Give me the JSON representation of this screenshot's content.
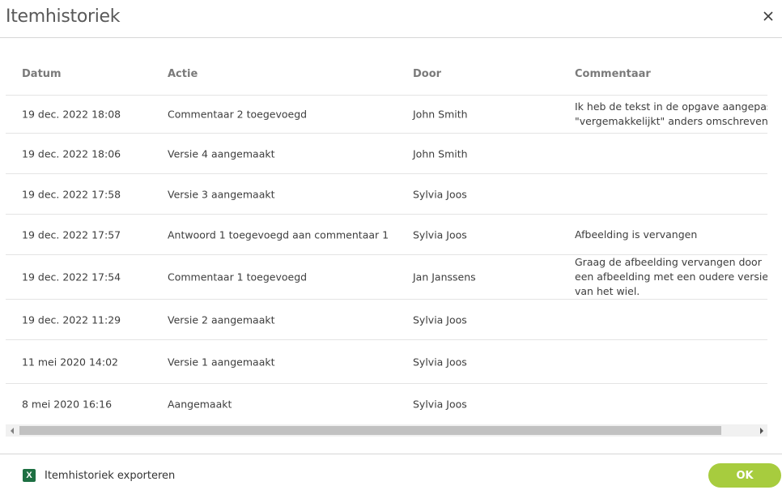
{
  "dialog": {
    "title": "Itemhistoriek",
    "close_icon": "close-icon"
  },
  "table": {
    "headers": {
      "date": "Datum",
      "action": "Actie",
      "by": "Door",
      "comment": "Commentaar"
    },
    "rows": [
      {
        "date": "19 dec. 2022 18:08",
        "action": "Commentaar 2 toegevoegd",
        "by": "John Smith",
        "comment": "Ik heb de tekst in de opgave aangepast: \"vergemakkelijkt\" anders omschreven"
      },
      {
        "date": "19 dec. 2022 18:06",
        "action": "Versie 4 aangemaakt",
        "by": "John Smith",
        "comment": ""
      },
      {
        "date": "19 dec. 2022 17:58",
        "action": "Versie 3 aangemaakt",
        "by": "Sylvia Joos",
        "comment": ""
      },
      {
        "date": "19 dec. 2022 17:57",
        "action": "Antwoord 1 toegevoegd aan commentaar 1",
        "by": "Sylvia Joos",
        "comment": "Afbeelding is vervangen"
      },
      {
        "date": "19 dec. 2022 17:54",
        "action": "Commentaar 1 toegevoegd",
        "by": "Jan Janssens",
        "comment": "Graag de afbeelding vervangen door een afbeelding met een oudere versie van het wiel."
      },
      {
        "date": "19 dec. 2022 11:29",
        "action": "Versie 2 aangemaakt",
        "by": "Sylvia Joos",
        "comment": ""
      },
      {
        "date": "11 mei 2020 14:02",
        "action": "Versie 1 aangemaakt",
        "by": "Sylvia Joos",
        "comment": ""
      },
      {
        "date": "8 mei 2020 16:16",
        "action": "Aangemaakt",
        "by": "Sylvia Joos",
        "comment": ""
      }
    ]
  },
  "footer": {
    "export_label": "Itemhistoriek exporteren",
    "export_icon_letter": "X",
    "ok_label": "OK"
  },
  "colors": {
    "ok_button": "#a7cc3e",
    "excel_icon": "#1d6f42",
    "header_text": "#7a7a7a",
    "divider": "#e4e4e4"
  }
}
